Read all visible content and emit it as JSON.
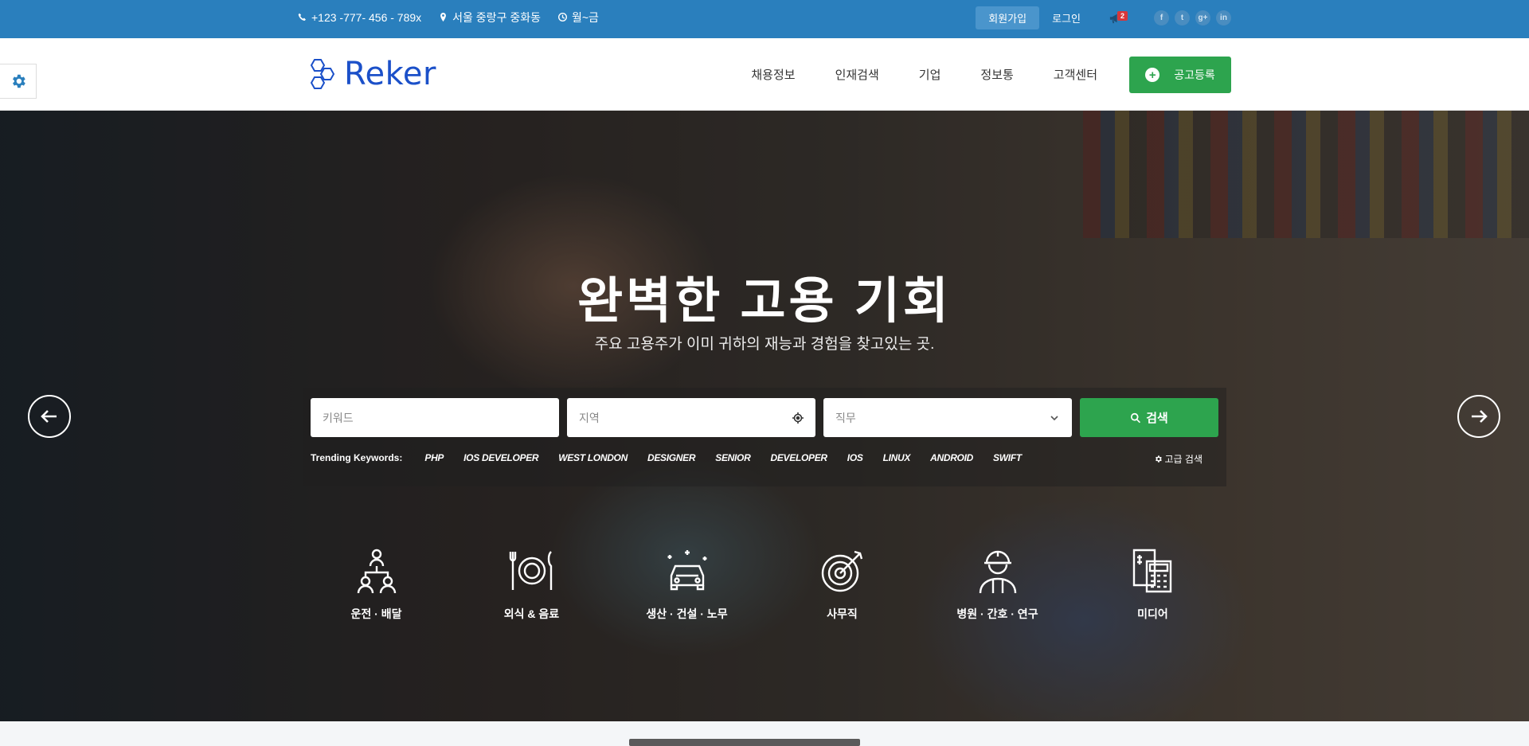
{
  "topbar": {
    "phone": "+123 -777- 456 - 789x",
    "address": "서울 중랑구 중화동",
    "hours": "월~금",
    "signup": "회원가입",
    "login": "로그인",
    "notification_count": "2",
    "socials": [
      "f",
      "t",
      "g+",
      "in"
    ]
  },
  "header": {
    "logo_text": "Reker",
    "nav": [
      "채용정보",
      "인재검색",
      "기업",
      "정보통",
      "고객센터"
    ],
    "post_job": "공고등록"
  },
  "hero": {
    "title": "완벽한 고용 기회",
    "subtitle": "주요 고용주가 이미 귀하의 재능과 경험을 찾고있는 곳.",
    "search": {
      "keyword_placeholder": "키워드",
      "location_placeholder": "지역",
      "job_placeholder": "직무",
      "button": "검색"
    },
    "trending_label": "Trending Keywords:",
    "trending": [
      "PHP",
      "IOS DEVELOPER",
      "WEST LONDON",
      "DESIGNER",
      "SENIOR",
      "DEVELOPER",
      "IOS",
      "LINUX",
      "ANDROID",
      "SWIFT"
    ],
    "advanced_search": "고급 검색",
    "categories": [
      {
        "name": "운전 · 배달",
        "icon": "people-network-icon"
      },
      {
        "name": "외식 & 음료",
        "icon": "dining-icon"
      },
      {
        "name": "생산 · 건설 · 노무",
        "icon": "car-icon"
      },
      {
        "name": "사무직",
        "icon": "target-icon"
      },
      {
        "name": "병원 · 간호 · 연구",
        "icon": "worker-icon"
      },
      {
        "name": "미디어",
        "icon": "calculator-icon"
      }
    ]
  },
  "colors": {
    "topbar": "#2a7fbd",
    "brand": "#1b50c9",
    "accent_green": "#2da44e"
  }
}
